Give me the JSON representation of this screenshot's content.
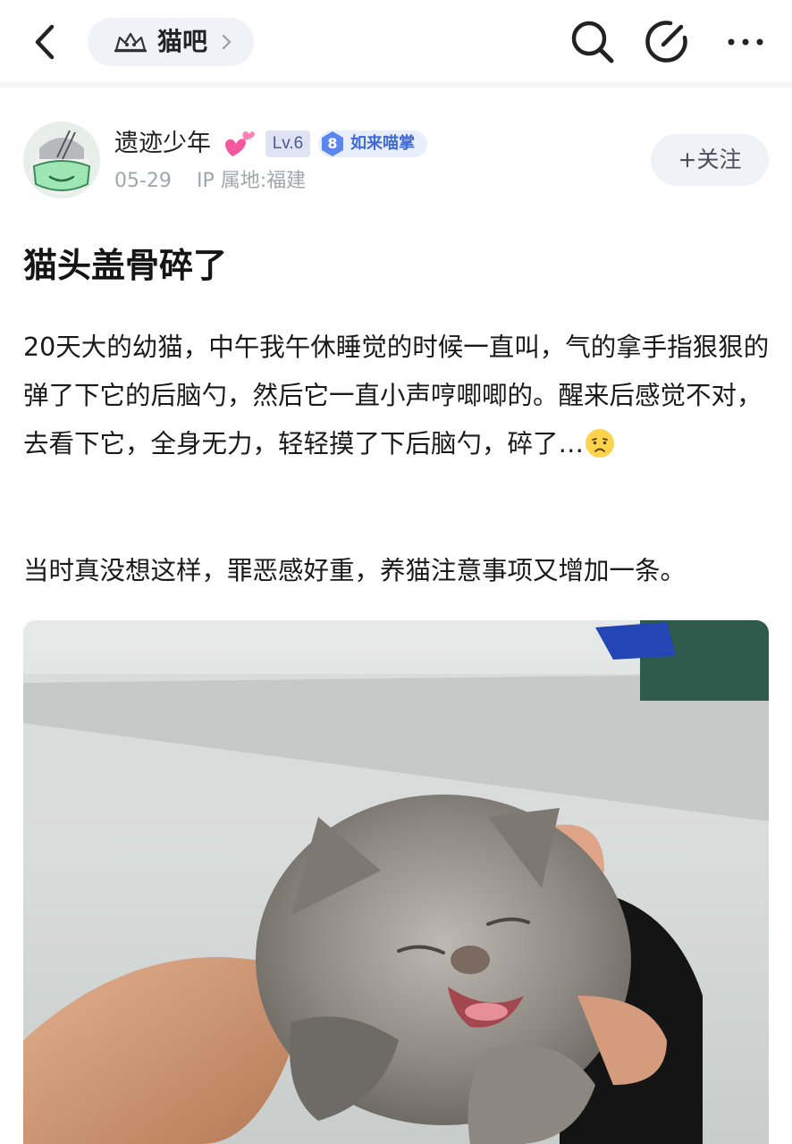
{
  "header": {
    "forum_name": "猫吧",
    "icons": [
      "back-arrow-icon",
      "forum-logo-icon",
      "chevron-right-icon",
      "search-icon",
      "edit-icon",
      "more-icon"
    ]
  },
  "author": {
    "name": "遗迹少年",
    "level": "Lv.6",
    "badge_number": "8",
    "badge_title": "如来喵掌",
    "date": "05-29",
    "ip_location": "IP 属地:福建",
    "follow_label": "+关注",
    "icons": [
      "avatar-image",
      "sparkling-hearts-icon"
    ]
  },
  "post": {
    "title": "猫头盖骨碎了",
    "paragraph1": "20天大的幼猫，中午我午休睡觉的时候一直叫，气的拿手指狠狠的弹了下它的后脑勺，然后它一直小声哼唧唧的。醒来后感觉不对，去看下它，全身无力，轻轻摸了下后脑勺，碎了…",
    "paragraph2": "当时真没想这样，罪恶感好重，养猫注意事项又增加一条。",
    "icons": [
      "sad-face-emoji",
      "kitten-photo"
    ]
  },
  "colors": {
    "accent_blue": "#3f6ad7",
    "meta_gray": "#a3a5ad",
    "pill_bg": "#f1f2f8"
  }
}
